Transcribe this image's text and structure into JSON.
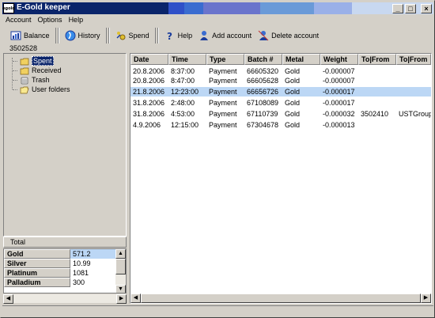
{
  "window": {
    "title": "E-Gold keeper",
    "app_icon_text": "egold"
  },
  "menu": [
    {
      "label": "Account"
    },
    {
      "label": "Options"
    },
    {
      "label": "Help"
    }
  ],
  "toolbar": {
    "balance": "Balance",
    "history": "History",
    "spend": "Spend",
    "help": "Help",
    "add_account": "Add account",
    "delete_account": "Delete account"
  },
  "account_number": "3502528",
  "tree": [
    {
      "label": "Spent",
      "icon": "folder-icon",
      "selected": true
    },
    {
      "label": "Received",
      "icon": "folder-icon",
      "selected": false
    },
    {
      "label": "Trash",
      "icon": "trash-icon",
      "selected": false
    },
    {
      "label": "User folders",
      "icon": "folder-icon",
      "selected": false
    }
  ],
  "totals": {
    "header": "Total",
    "rows": [
      {
        "metal": "Gold",
        "value": "571.2",
        "highlight": true
      },
      {
        "metal": "Silver",
        "value": "10.99",
        "highlight": false
      },
      {
        "metal": "Platinum",
        "value": "1081",
        "highlight": false
      },
      {
        "metal": "Palladium",
        "value": "300",
        "highlight": false
      }
    ]
  },
  "grid": {
    "columns": [
      "Date",
      "Time",
      "Type",
      "Batch #",
      "Metal",
      "Weight",
      "To|From",
      "To|From"
    ],
    "rows": [
      [
        "20.8.2006",
        "8:37:00",
        "Payment",
        "66605320",
        "Gold",
        "-0.000007",
        "",
        ""
      ],
      [
        "20.8.2006",
        "8:47:00",
        "Payment",
        "66605628",
        "Gold",
        "-0.000007",
        "",
        ""
      ],
      [
        "21.8.2006",
        "12:23:00",
        "Payment",
        "66656726",
        "Gold",
        "-0.000017",
        "",
        ""
      ],
      [
        "31.8.2006",
        "2:48:00",
        "Payment",
        "67108089",
        "Gold",
        "-0.000017",
        "",
        ""
      ],
      [
        "31.8.2006",
        "4:53:00",
        "Payment",
        "67110739",
        "Gold",
        "-0.000032",
        "3502410",
        "USTGroup"
      ],
      [
        "4.9.2006",
        "12:15:00",
        "Payment",
        "67304678",
        "Gold",
        "-0.000013",
        "",
        ""
      ]
    ],
    "selected_row": 2
  },
  "colors": {
    "title_gradient": [
      "#0a246a",
      "#1a3c9c",
      "#3a6cd0",
      "#6a8ee0",
      "#a6caf0",
      "#c8d8f0"
    ],
    "selection": "#bcd7f5"
  }
}
